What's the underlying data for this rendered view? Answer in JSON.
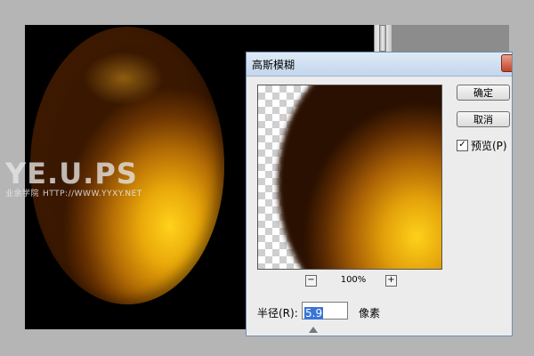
{
  "watermark": {
    "logo": "YE.U.PS",
    "sub_cn": "业余学院",
    "sub_url": "HTTP://WWW.YYXY.NET"
  },
  "dialog": {
    "title": "高斯模糊",
    "ok_label": "确定",
    "cancel_label": "取消",
    "preview_checked": true,
    "preview_label": "预览(P)",
    "zoom_level": "100%",
    "zoom_out_symbol": "−",
    "zoom_in_symbol": "+",
    "radius_label": "半径(R):",
    "radius_value": "5.9",
    "radius_unit": "像素"
  },
  "colors": {
    "egg_highlight": "#ffd21a",
    "egg_mid": "#e9a80a",
    "egg_dark": "#6b3402",
    "canvas_bg": "#000000",
    "selection": "#3875d7"
  }
}
